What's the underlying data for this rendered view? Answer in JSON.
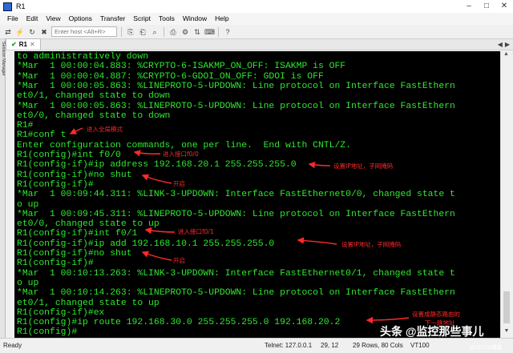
{
  "window": {
    "title": "R1"
  },
  "menu": [
    "File",
    "Edit",
    "View",
    "Options",
    "Transfer",
    "Script",
    "Tools",
    "Window",
    "Help"
  ],
  "toolbar": {
    "host_placeholder": "Enter host <Alt+R>"
  },
  "tab": {
    "label": "R1"
  },
  "side_panel": {
    "label": "Session Manager"
  },
  "terminal": {
    "lines": [
      "to administratively down",
      "*Mar  1 00:00:04.883: %CRYPTO-6-ISAKMP_ON_OFF: ISAKMP is OFF",
      "*Mar  1 00:00:04.887: %CRYPTO-6-GDOI_ON_OFF: GDOI is OFF",
      "*Mar  1 00:00:05.863: %LINEPROTO-5-UPDOWN: Line protocol on Interface FastEthern",
      "et0/1, changed state to down",
      "*Mar  1 00:00:05.863: %LINEPROTO-5-UPDOWN: Line protocol on Interface FastEthern",
      "et0/0, changed state to down",
      "R1#",
      "R1#conf t",
      "Enter configuration commands, one per line.  End with CNTL/Z.",
      "R1(config)#int f0/0",
      "R1(config-if)#ip address 192.168.20.1 255.255.255.0",
      "R1(config-if)#no shut",
      "R1(config-if)#",
      "*Mar  1 00:09:44.311: %LINK-3-UPDOWN: Interface FastEthernet0/0, changed state t",
      "o up",
      "*Mar  1 00:09:45.311: %LINEPROTO-5-UPDOWN: Line protocol on Interface FastEthern",
      "et0/0, changed state to up",
      "R1(config-if)#int f0/1",
      "R1(config-if)#ip add 192.168.10.1 255.255.255.0",
      "R1(config-if)#no shut",
      "R1(config-if)#",
      "*Mar  1 00:10:13.263: %LINK-3-UPDOWN: Interface FastEthernet0/1, changed state t",
      "o up",
      "*Mar  1 00:10:14.263: %LINEPROTO-5-UPDOWN: Line protocol on Interface FastEthern",
      "et0/1, changed state to up",
      "R1(config-if)#ex",
      "R1(config)#ip route 192.168.30.0 255.255.255.0 192.168.20.2",
      "R1(config)#"
    ]
  },
  "annotations": {
    "enter_global": "进入全局模式",
    "enter_if0": "进入接口f0/0",
    "set_ip1": "设置IP地址，子网掩码",
    "enable1": "开启",
    "enter_if1": "进入接口f0/1",
    "set_ip2": "设置IP地址，子网掩码",
    "enable2": "开启",
    "static_route_1": "设置成静态路由的",
    "static_route_2": "下一跳地址"
  },
  "status": {
    "ready": "Ready",
    "conn": "Telnet: 127.0.0.1",
    "pos": "29,  12",
    "size": "29 Rows, 80 Cols",
    "term": "VT100"
  },
  "watermark": {
    "main": "头条 @监控那些事儿",
    "sub": "@51CTO博客"
  },
  "colors": {
    "terminal_bg": "#000000",
    "terminal_fg": "#2fe82f",
    "annotation": "#ff2a2a"
  },
  "icons": [
    "connect-icon",
    "quick-connect-icon",
    "reconnect-icon",
    "disconnect-icon",
    "copy-icon",
    "paste-icon",
    "find-icon",
    "print-icon",
    "settings-icon",
    "sftp-icon",
    "keymap-icon",
    "help-icon"
  ]
}
